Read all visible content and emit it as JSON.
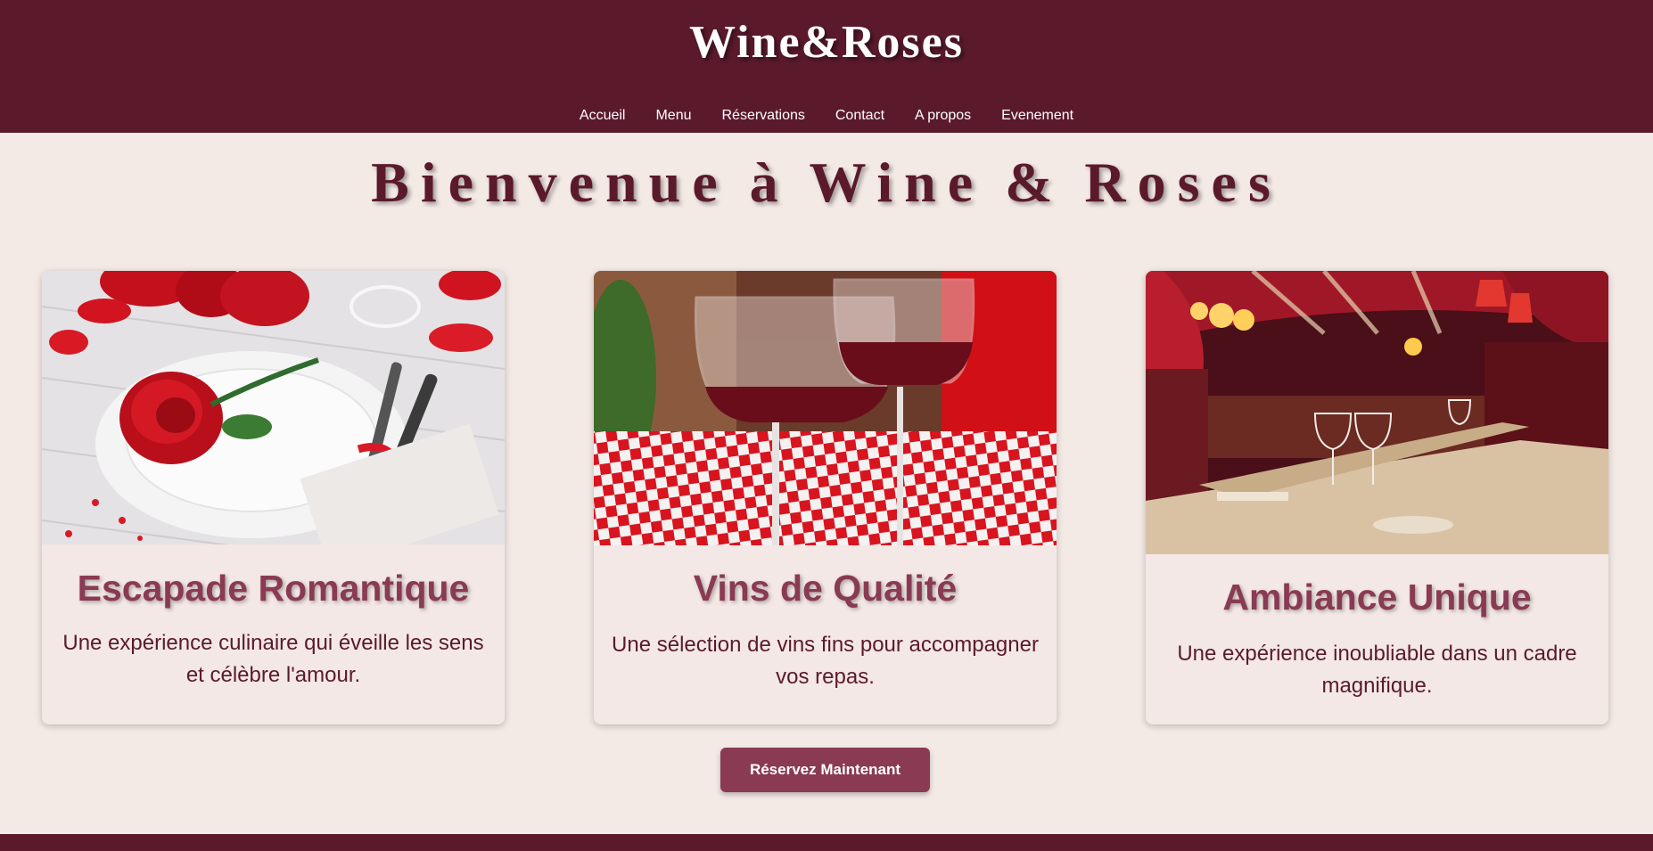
{
  "header": {
    "brand": "Wine&Roses",
    "nav": [
      "Accueil",
      "Menu",
      "Réservations",
      "Contact",
      "A propos",
      "Evenement"
    ]
  },
  "hero": {
    "title": "Bienvenue à Wine & Roses"
  },
  "cards": [
    {
      "title": "Escapade Romantique",
      "text": "Une expérience culinaire qui éveille les sens et célèbre l'amour.",
      "image": "rose-on-plate-table-setting"
    },
    {
      "title": "Vins de Qualité",
      "text": "Une sélection de vins fins pour accompagner vos repas.",
      "image": "red-wine-glasses-checkered-tablecloth"
    },
    {
      "title": "Ambiance Unique",
      "text": "Une expérience inoubliable dans un cadre magnifique.",
      "image": "restaurant-dining-room-interior"
    }
  ],
  "cta": {
    "label": "Réservez Maintenant"
  },
  "colors": {
    "header_bg": "#5b1a2c",
    "page_bg": "#f3e9e5",
    "accent": "#8a3a53"
  }
}
